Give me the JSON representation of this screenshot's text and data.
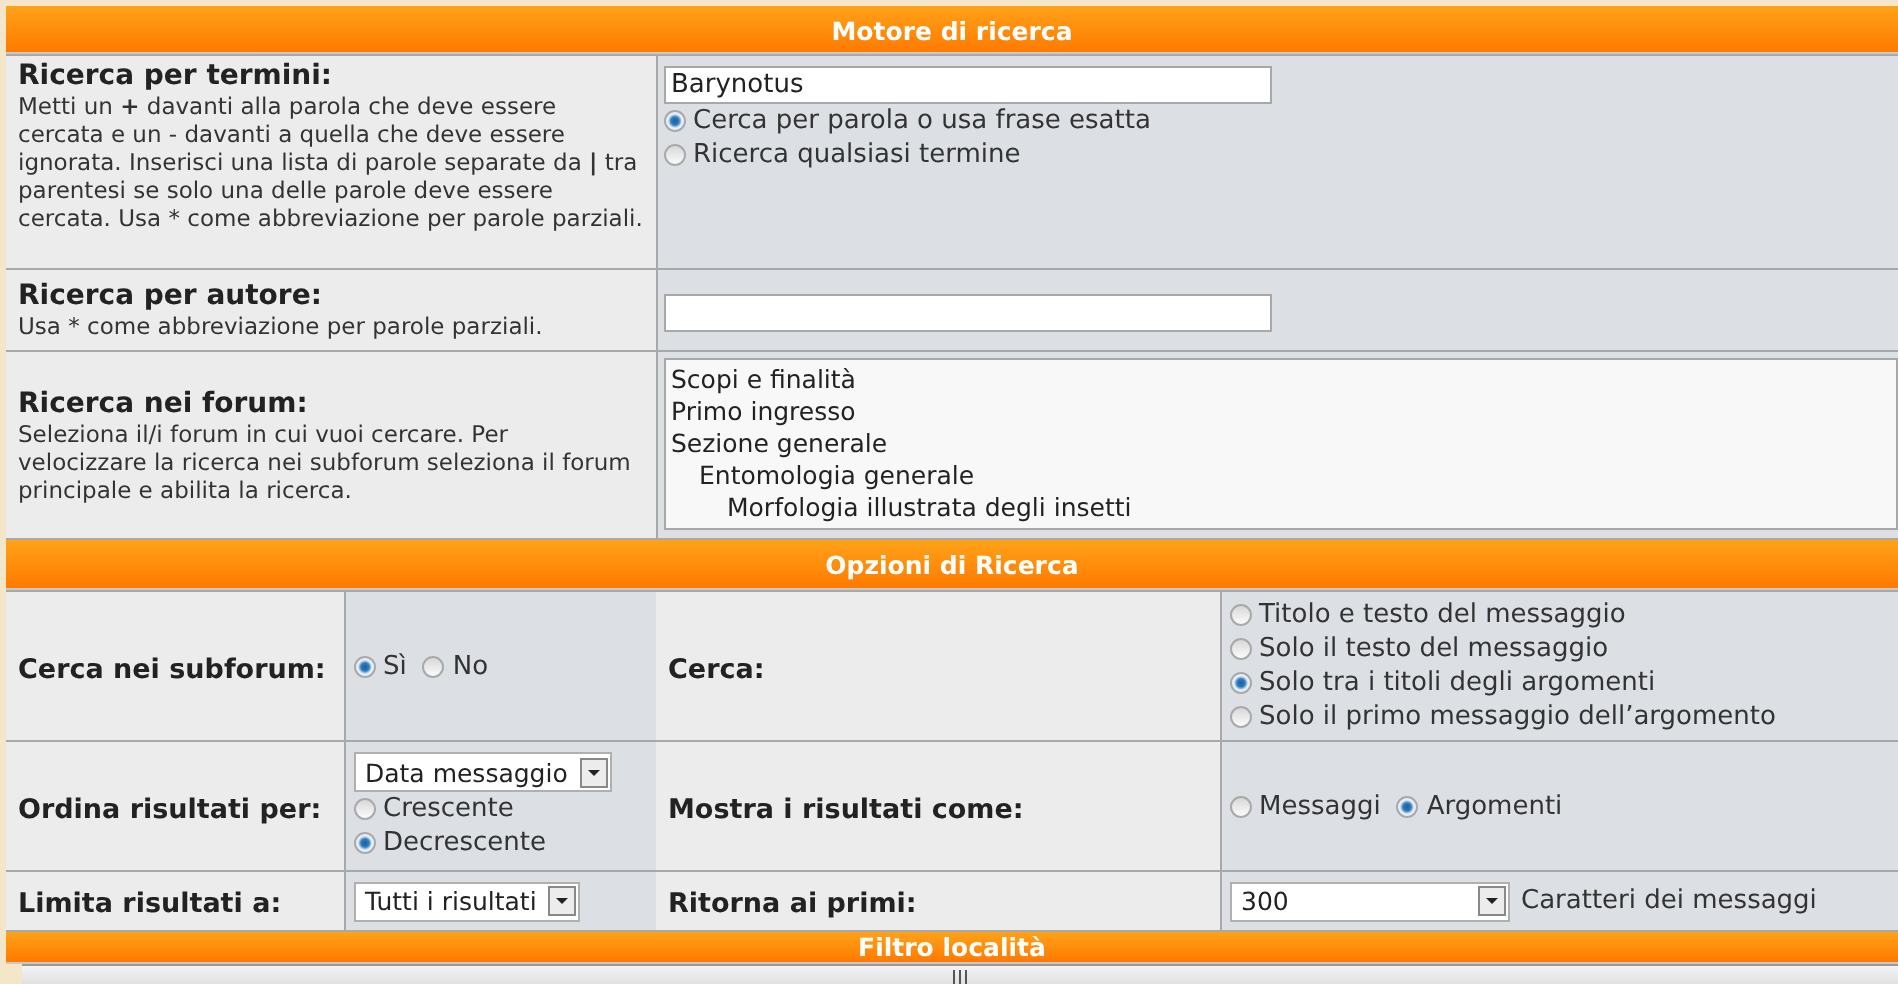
{
  "search_engine": {
    "title": "Motore di ricerca",
    "terms": {
      "label": "Ricerca per termini:",
      "hint": "Metti un **+** davanti alla parola che deve essere cercata e un - davanti a quella che deve essere ignorata. Inserisci una lista di parole separate da **|** tra parentesi se solo una delle parole deve essere cercata. Usa * come abbreviazione per parole parziali.",
      "value": "Barynotus",
      "options": [
        {
          "label": "Cerca per parola o usa frase esatta",
          "selected": true
        },
        {
          "label": "Ricerca qualsiasi termine",
          "selected": false
        }
      ]
    },
    "author": {
      "label": "Ricerca per autore:",
      "hint": "Usa * come abbreviazione per parole parziali."
    },
    "forums": {
      "label": "Ricerca nei forum:",
      "hint": "Seleziona il/i forum in cui vuoi cercare. Per velocizzare la ricerca nei subforum seleziona il forum principale e abilita la ricerca.",
      "items": [
        {
          "label": "Scopi e finalità"
        },
        {
          "label": "Primo ingresso"
        },
        {
          "label": "Sezione generale",
          "children": [
            {
              "label": "Entomologia generale",
              "children": [
                {
                  "label": "Morfologia illustrata degli insetti"
                }
              ]
            }
          ]
        }
      ]
    }
  },
  "search_options": {
    "title": "Opzioni di Ricerca",
    "rows": [
      {
        "pairs": [
          {
            "label": "Cerca nei subforum:",
            "controls": [
              {
                "kind": "radio-row",
                "options": [
                  {
                    "label": "Sì",
                    "selected": true
                  },
                  {
                    "label": "No",
                    "selected": false
                  }
                ]
              }
            ]
          },
          {
            "label": "Cerca:",
            "controls": [
              {
                "kind": "radio-list",
                "options": [
                  {
                    "label": "Titolo e testo del messaggio",
                    "selected": false
                  },
                  {
                    "label": "Solo il testo del messaggio",
                    "selected": false
                  },
                  {
                    "label": "Solo tra i titoli degli argomenti",
                    "selected": true
                  },
                  {
                    "label": "Solo il primo messaggio dell’argomento",
                    "selected": false
                  }
                ]
              }
            ]
          }
        ]
      },
      {
        "pairs": [
          {
            "label": "Ordina risultati per:",
            "controls": [
              {
                "kind": "select",
                "value": "Data messaggio"
              },
              {
                "kind": "radio-list",
                "options": [
                  {
                    "label": "Crescente",
                    "selected": false
                  },
                  {
                    "label": "Decrescente",
                    "selected": true
                  }
                ]
              }
            ]
          },
          {
            "label": "Mostra i risultati come:",
            "controls": [
              {
                "kind": "radio-row",
                "options": [
                  {
                    "label": "Messaggi",
                    "selected": false
                  },
                  {
                    "label": "Argomenti",
                    "selected": true
                  }
                ]
              }
            ]
          }
        ]
      },
      {
        "pairs": [
          {
            "label": "Limita risultati a:",
            "controls": [
              {
                "kind": "select",
                "value": "Tutti i risultati"
              }
            ]
          },
          {
            "label": "Ritorna ai primi:",
            "controls": [
              {
                "kind": "select",
                "value": "300"
              },
              {
                "kind": "text",
                "text": "Caratteri dei messaggi"
              }
            ]
          }
        ]
      }
    ]
  },
  "next_section": {
    "title": "Filtro località"
  }
}
